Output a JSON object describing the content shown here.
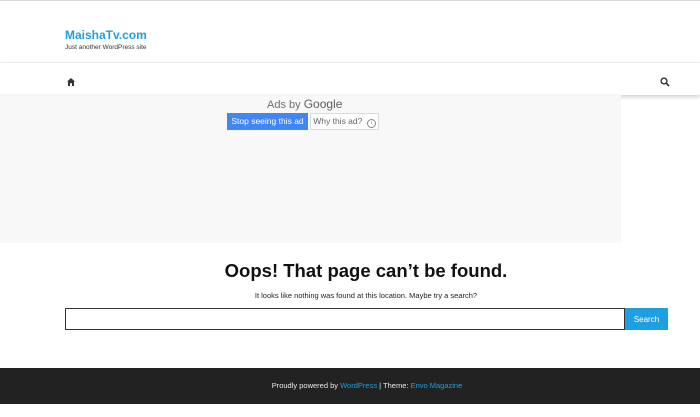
{
  "header": {
    "site_title": "MaishaTv.com",
    "site_description": "Just another WordPress site"
  },
  "nav": {
    "home_icon": "home-icon",
    "search_icon": "search-icon"
  },
  "ad": {
    "ads_by": "Ads by",
    "google": "Google",
    "stop_button": "Stop seeing this ad",
    "why_button": "Why this ad?",
    "info_symbol": "i"
  },
  "main": {
    "heading": "Oops! That page can’t be found.",
    "message": "It looks like nothing was found at this location. Maybe try a search?",
    "search_value": "",
    "search_button": "Search"
  },
  "footer": {
    "powered_prefix": "Proudly powered by",
    "wordpress_link": "WordPress",
    "separator": " | Theme: ",
    "theme_link": "Envo Magazine"
  },
  "colors": {
    "accent": "#1e9fe0",
    "ad_button": "#4285f4",
    "footer_bg": "#222222"
  }
}
